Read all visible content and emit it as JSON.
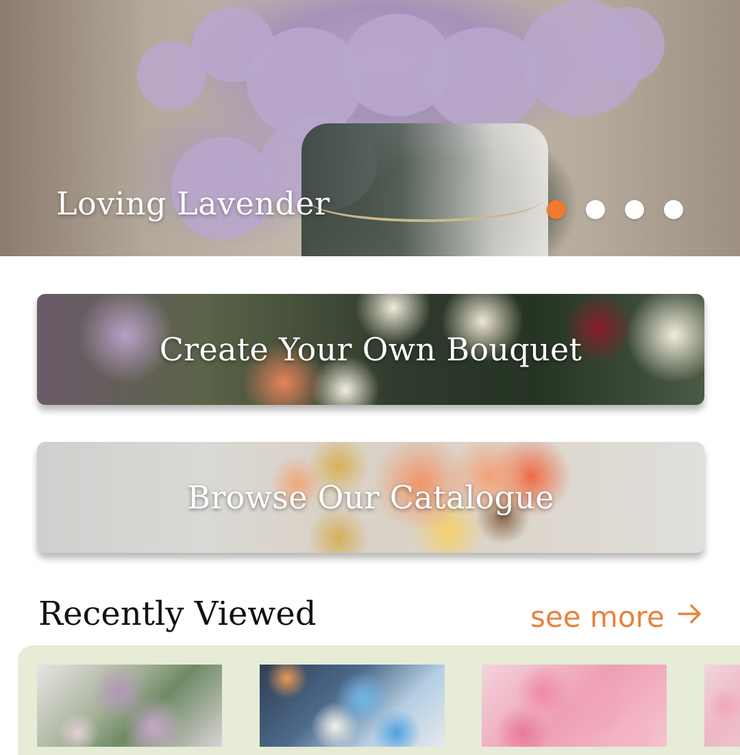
{
  "hero": {
    "title": "Loving Lavender",
    "slides": [
      {
        "active": true
      },
      {
        "active": false
      },
      {
        "active": false
      },
      {
        "active": false
      }
    ]
  },
  "actions": {
    "create": {
      "label": "Create Your Own Bouquet"
    },
    "browse": {
      "label": "Browse Our Catalogue"
    }
  },
  "recently_viewed": {
    "title": "Recently Viewed",
    "see_more": "see more",
    "items": [
      {
        "image": "lavender-white-bouquet"
      },
      {
        "image": "blue-white-bouquet"
      },
      {
        "image": "pink-roses-bouquet"
      },
      {
        "image": "pink-bouquet-partial"
      }
    ]
  },
  "colors": {
    "accent": "#f07a2e",
    "link": "#e8823c",
    "strip_bg": "#e6ecd6",
    "text": "#111111"
  },
  "icons": {
    "see_more_arrow": "arrow-right-icon"
  }
}
